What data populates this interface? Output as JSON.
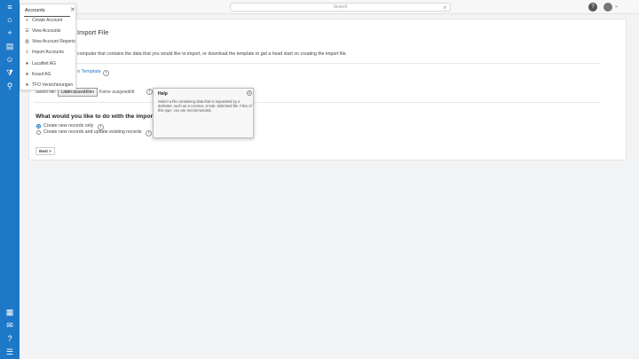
{
  "sidebar": {
    "items": [
      {
        "icon": "menu-icon",
        "glyph": "≡"
      },
      {
        "icon": "home-icon",
        "glyph": "⌂"
      },
      {
        "icon": "plus-icon",
        "glyph": "+"
      },
      {
        "icon": "building-icon",
        "glyph": "▤"
      },
      {
        "icon": "person-icon",
        "glyph": "☺"
      },
      {
        "icon": "filter-icon",
        "glyph": "⧩"
      },
      {
        "icon": "org-chart-icon",
        "glyph": "⚲"
      }
    ],
    "bottom_items": [
      {
        "icon": "report-icon",
        "glyph": "▦"
      },
      {
        "icon": "messages-icon",
        "glyph": "✉"
      },
      {
        "icon": "help-icon",
        "glyph": "?"
      },
      {
        "icon": "database-icon",
        "glyph": "☰"
      }
    ]
  },
  "topbar": {
    "search_placeholder": "Search",
    "search_icon": "⌕",
    "help_glyph": "?",
    "chevron": "⌄"
  },
  "dropdown": {
    "title": "Accounts",
    "close": "✕",
    "items": [
      {
        "label": "Create Account",
        "icon": "plus-icon",
        "glyph": "+"
      },
      {
        "label": "View Accounts",
        "icon": "list-icon",
        "glyph": "☰"
      },
      {
        "label": "View Account Reports",
        "icon": "bar-chart-icon",
        "glyph": "▥"
      },
      {
        "label": "Import Accounts",
        "icon": "upload-icon",
        "glyph": "⇪"
      },
      {
        "label": "Lucafleit AG",
        "icon": "star-icon",
        "glyph": "★"
      },
      {
        "label": "Knauf AG",
        "icon": "star-icon",
        "glyph": "★"
      },
      {
        "label": "TFO Versicherungen",
        "icon": "star-icon",
        "glyph": "★"
      }
    ]
  },
  "main": {
    "title": "Import File",
    "intro": "computer that contains the data that you would like to import, or download the template to get a head start on creating the import file.",
    "template_link": "n Template",
    "select_label": "Select file:",
    "file_button": "Datei auswählen",
    "no_file": "Keine ausgewählt",
    "question": "What would you like to do with the imported d",
    "radio_create": "Create new records only",
    "radio_update": "Create new records and update existing records",
    "next_button": "Next >",
    "info_glyph": "i"
  },
  "help": {
    "title": "Help",
    "close": "x",
    "text": "Select a file containing data that is separated by a delimiter, such as a comma- or tab- delimited file. Files of this type .csv are recommended."
  },
  "colors": {
    "sidebar": "#1e78c8",
    "accent": "#1e78c8",
    "background": "#f2f3f5"
  }
}
